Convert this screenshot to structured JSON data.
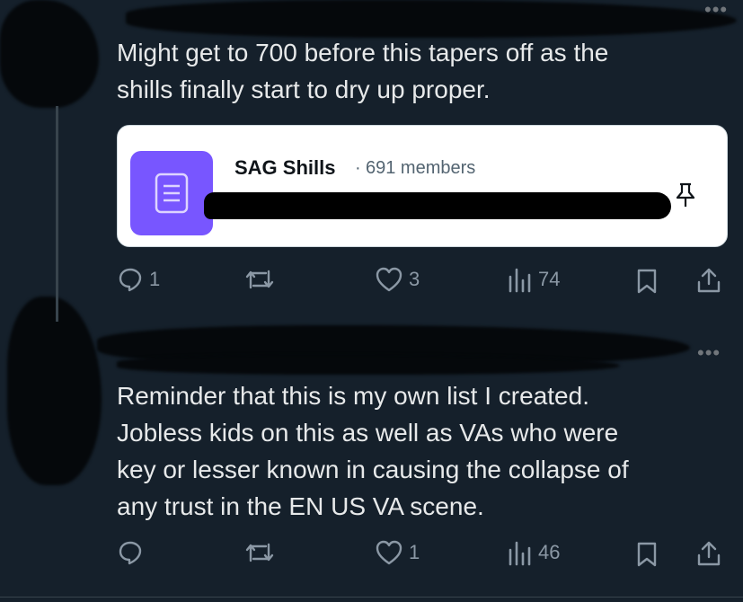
{
  "colors": {
    "background": "#15202b",
    "text": "#e7e9ea",
    "muted": "#8b98a5",
    "list_avatar": "#7856ff",
    "card_bg": "#ffffff"
  },
  "post1": {
    "text": "Might get to 700 before this tapers off as the\nshills finally start to dry up proper.",
    "list_card": {
      "name": "SAG Shills",
      "separator": "·",
      "members": "691 members",
      "avatar_icon": "list-icon",
      "pin_icon": "pin-icon"
    },
    "actions": {
      "replies": "1",
      "reposts": "",
      "likes": "3",
      "views": "74"
    }
  },
  "post2": {
    "text": "Reminder that this is my own list I created.\nJobless kids on this as well as VAs who were\nkey or lesser known in causing the collapse of\nany trust in the EN US VA scene.",
    "actions": {
      "replies": "",
      "reposts": "",
      "likes": "1",
      "views": "46"
    }
  },
  "more_icon": "•••"
}
